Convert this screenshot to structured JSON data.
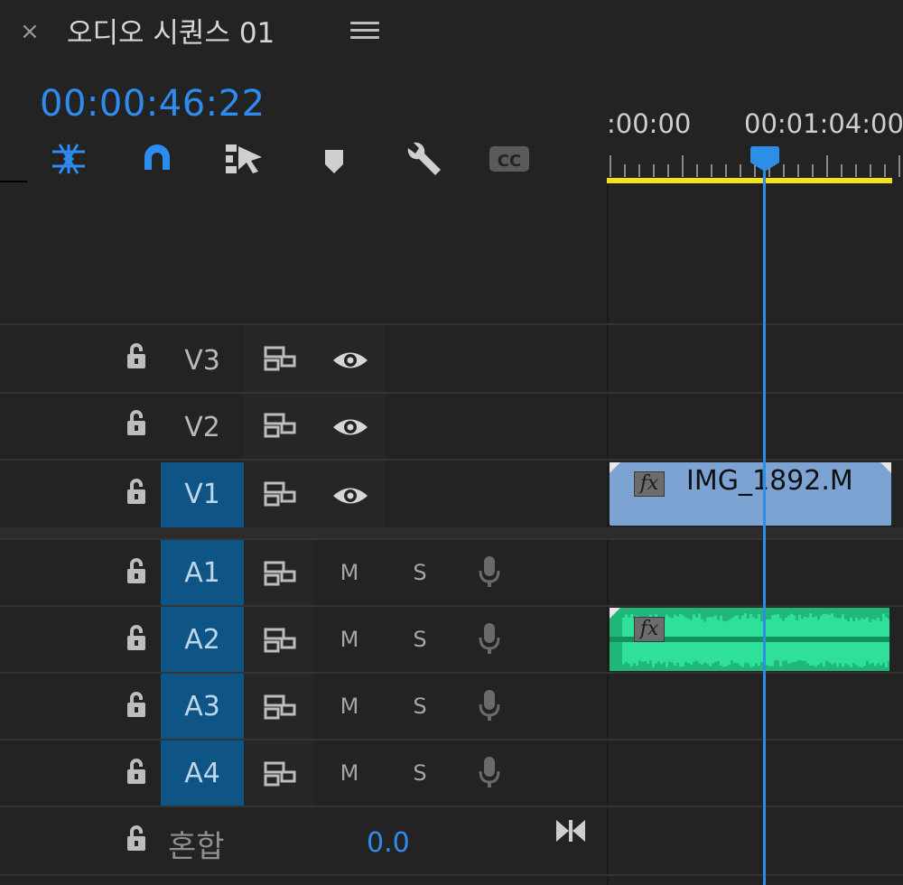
{
  "header": {
    "close": "×",
    "title": "오디오 시퀀스 01",
    "timecode": "00:00:46:22"
  },
  "tools": [
    {
      "name": "ripple-edit-icon",
      "active": true
    },
    {
      "name": "snap-magnet-icon",
      "active": true
    },
    {
      "name": "linked-selection-icon",
      "active": false
    },
    {
      "name": "add-marker-icon",
      "active": false
    },
    {
      "name": "timeline-settings-wrench-icon",
      "active": false
    },
    {
      "name": "captions-cc-icon",
      "active": false
    }
  ],
  "ruler": {
    "start": ":00:00",
    "marker": "00:01:04:00"
  },
  "tracks": {
    "video": [
      {
        "label": "V3",
        "active": false
      },
      {
        "label": "V2",
        "active": false
      },
      {
        "label": "V1",
        "active": true
      }
    ],
    "audio": [
      {
        "label": "A1",
        "mute": "M",
        "solo": "S",
        "active": true
      },
      {
        "label": "A2",
        "mute": "M",
        "solo": "S",
        "active": true
      },
      {
        "label": "A3",
        "mute": "M",
        "solo": "S",
        "active": true
      },
      {
        "label": "A4",
        "mute": "M",
        "solo": "S",
        "active": true
      }
    ],
    "mix": {
      "label": "혼합",
      "value": "0.0"
    }
  },
  "clips": {
    "video_name": "IMG_1892.M",
    "fx": "fx"
  },
  "colors": {
    "accent": "#2e8cf0",
    "active_track": "#0e5585",
    "video_clip": "#7da3d3",
    "audio_clip": "#1fb77a",
    "work_area": "#f0e21e"
  }
}
